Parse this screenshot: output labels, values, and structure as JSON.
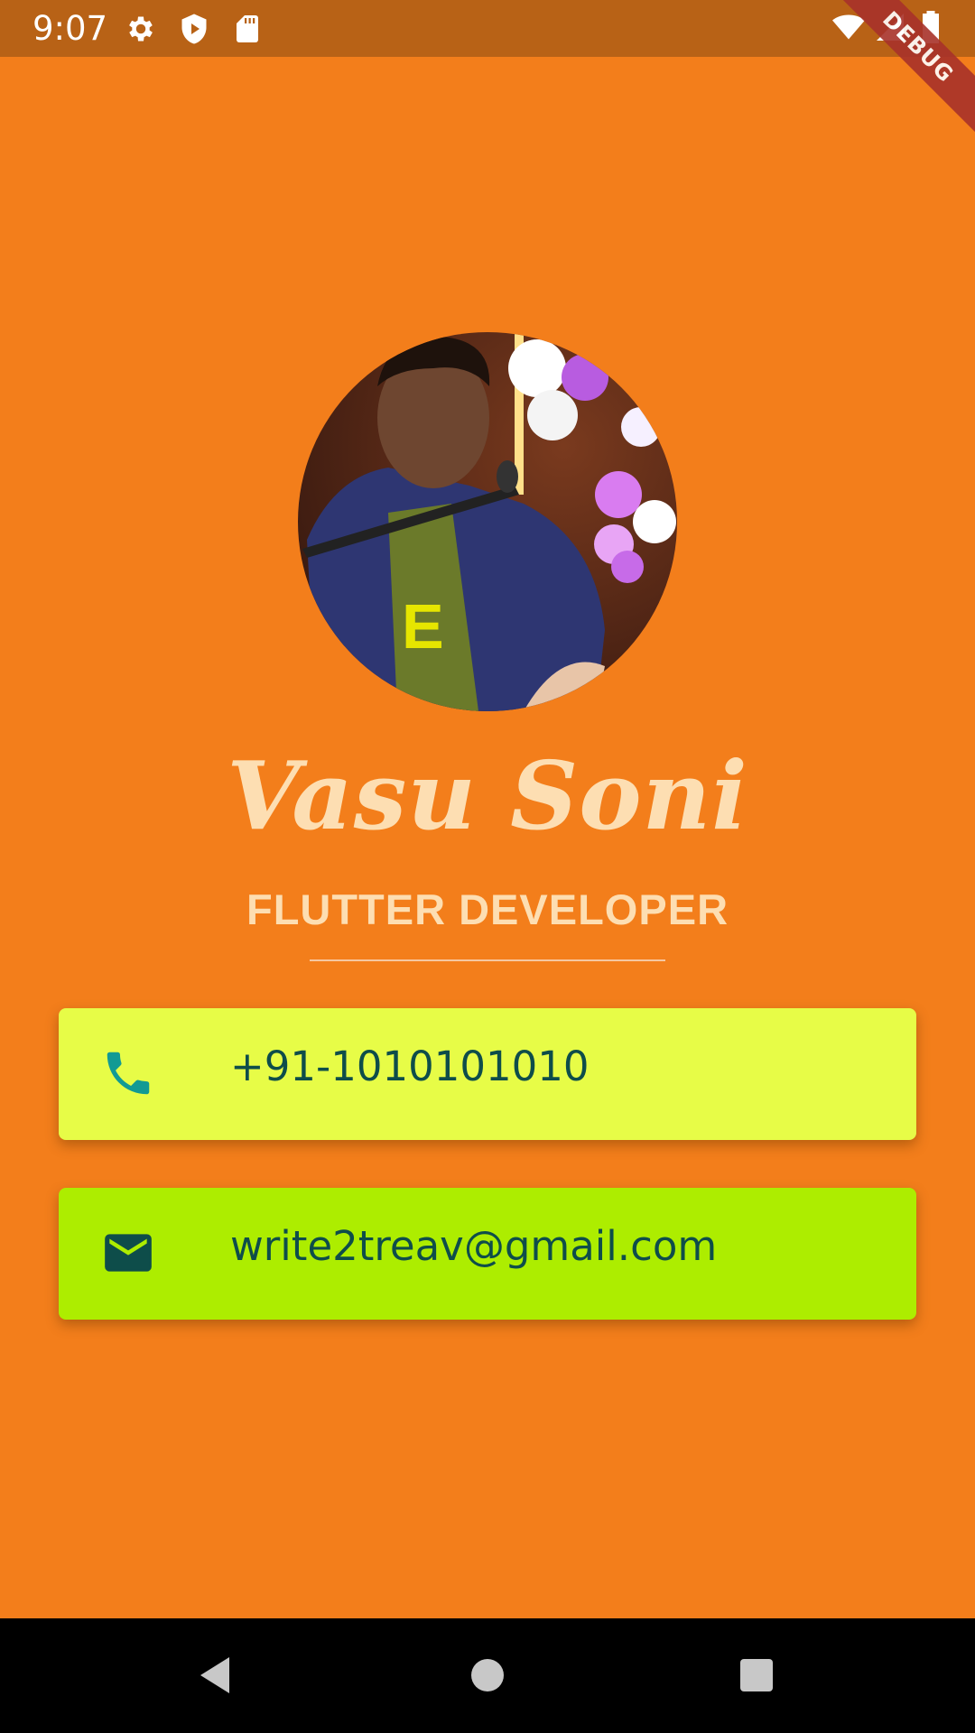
{
  "status_bar": {
    "time": "9:07",
    "left_icons": [
      "gear-icon",
      "shield-play-icon",
      "sd-card-icon"
    ],
    "right_icons": [
      "wifi-icon",
      "signal-icon",
      "battery-icon"
    ]
  },
  "debug_banner": {
    "label": "DEBUG"
  },
  "profile": {
    "name": "Vasu Soni",
    "role": "FLUTTER DEVELOPER"
  },
  "contacts": {
    "phone": {
      "icon": "phone-icon",
      "value": "+91-1010101010"
    },
    "email": {
      "icon": "mail-icon",
      "value": "write2treav@gmail.com"
    }
  },
  "colors": {
    "background": "#F37E1B",
    "status_bar": "#B86216",
    "phone_card": "#E7FC47",
    "email_card": "#ADED00",
    "card_text": "#0E4D4A",
    "name_text": "#FDDEB2"
  },
  "nav_bar": {
    "buttons": [
      "back-icon",
      "home-icon",
      "recents-icon"
    ]
  }
}
